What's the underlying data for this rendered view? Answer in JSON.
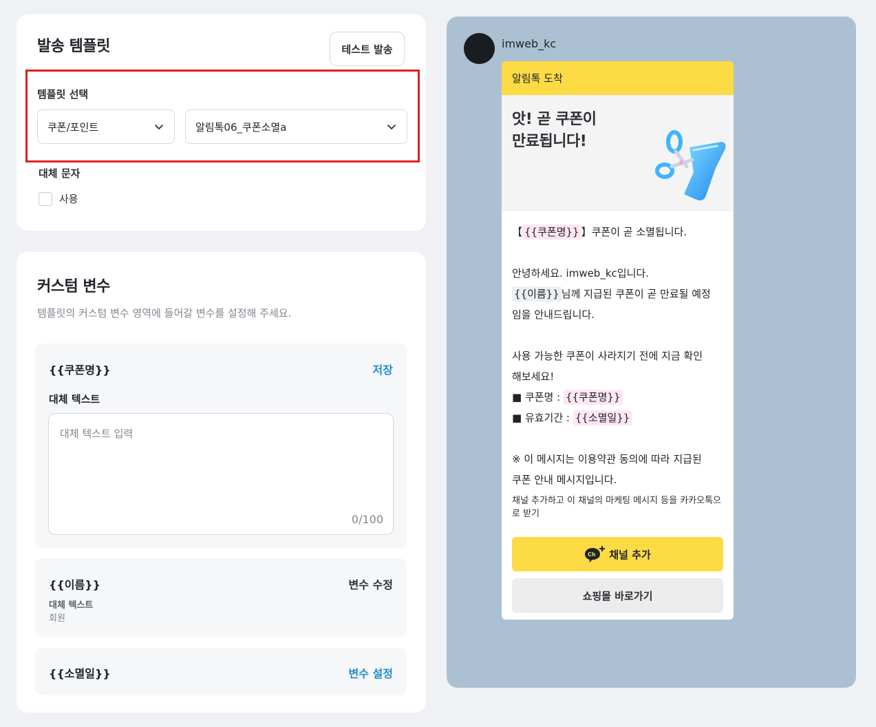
{
  "template_section": {
    "title": "발송 템플릿",
    "test_send_label": "테스트 발송",
    "select_label": "템플릿 선택",
    "category_value": "쿠폰/포인트",
    "template_value": "알림톡06_쿠폰소멸a",
    "alt_message_label": "대체 문자",
    "use_label": "사용",
    "highlight_color": "#e02020"
  },
  "custom_vars": {
    "title": "커스텀 변수",
    "description": "템플릿의 커스텀 변수 영역에 들어갈 변수를 설정해 주세요.",
    "items": [
      {
        "name": "{{쿠폰명}}",
        "action": "저장",
        "alt_text_label": "대체 텍스트",
        "placeholder": "대체 텍스트 입력",
        "counter": "0/100"
      },
      {
        "name": "{{이름}}",
        "action": "변수 수정",
        "alt_text_label": "대체 텍스트",
        "alt_text_value": "회원"
      },
      {
        "name": "{{소멸일}}",
        "action": "변수 설정"
      }
    ]
  },
  "preview": {
    "sender": "imweb_kc",
    "header": "알림톡 도착",
    "hero_title_line1": "앗! 곧 쿠폰이",
    "hero_title_line2": "만료됩니다!",
    "line1_open": "【",
    "line1_tag": "{{쿠폰명}}",
    "line1_rest": "】쿠폰이 곧 소멸됩니다.",
    "greeting": "안녕하세요. imweb_kc입니다.",
    "name_tag": "{{이름}}",
    "name_rest": "님께 지급된 쿠폰이 곧 만료될 예정",
    "line3": "임을 안내드립니다.",
    "line4": "사용 가능한 쿠폰이 사라지기 전에 지금 확인",
    "line5": "해보세요!",
    "bullet1_label": "■ 쿠폰명 : ",
    "bullet1_tag": "{{쿠폰명}}",
    "bullet2_label": "■ 유효기간 : ",
    "bullet2_tag": "{{소멸일}}",
    "notice1": "※ 이 메시지는 이용약관 동의에 따라 지급된",
    "notice2": "쿠폰 안내 메시지입니다.",
    "foot_note": "채널 추가하고 이 채널의 마케팅 메시지 등을 카카오톡으로 받기",
    "channel_button": "채널 추가",
    "shop_button": "쇼핑몰 바로가기",
    "colors": {
      "background": "#abc0d2",
      "kakao_yellow": "#fcdb45",
      "tag_pink": "#fde6f2"
    }
  },
  "icons": [
    "chevron-down-icon",
    "scissors-coupon-illustration",
    "kakao-channel-icon"
  ]
}
